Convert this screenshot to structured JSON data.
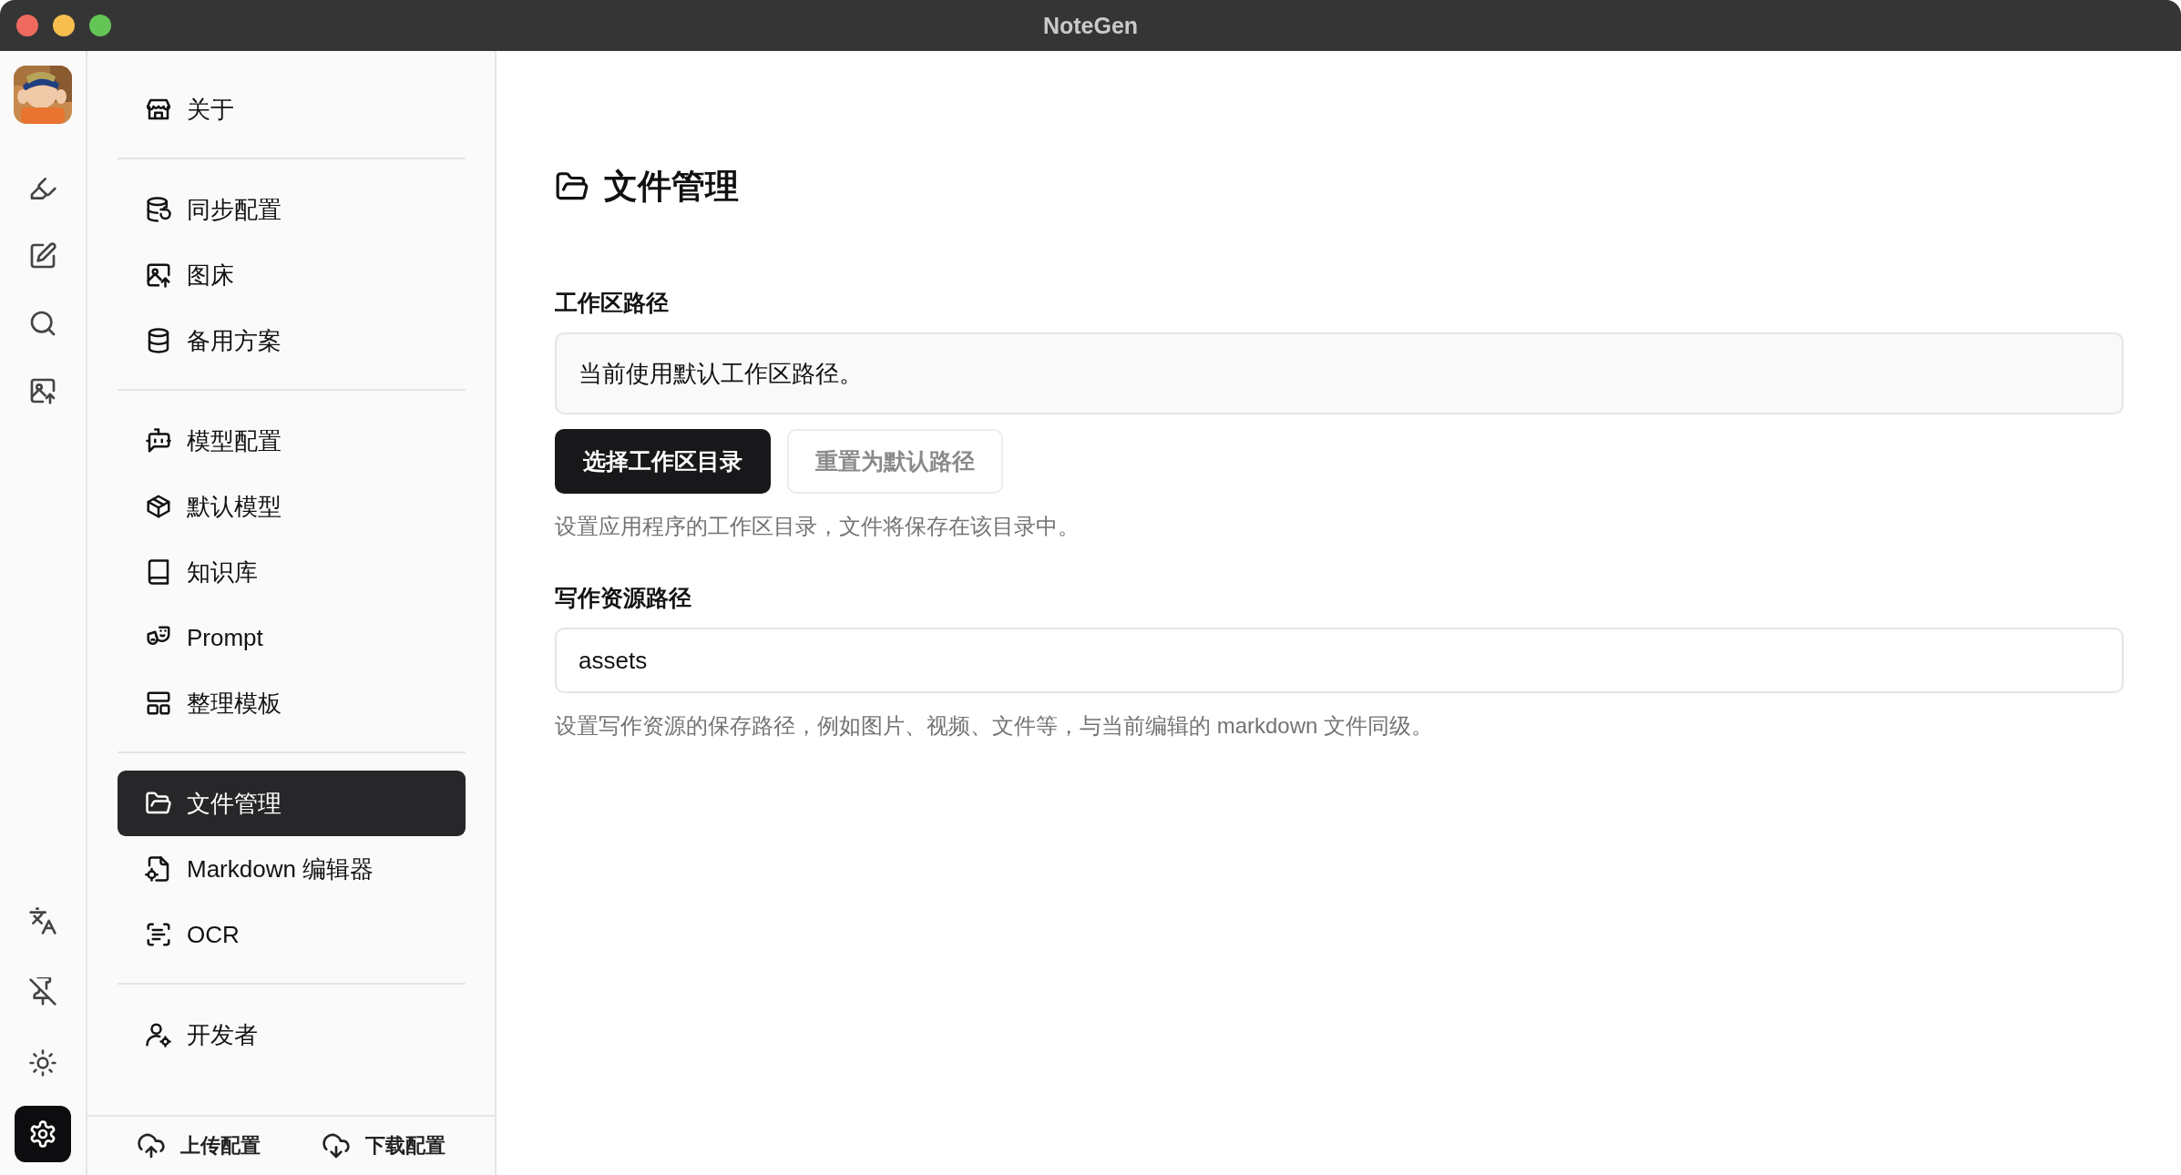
{
  "window": {
    "title": "NoteGen"
  },
  "rail": {
    "top": [
      {
        "selected": false
      },
      {
        "selected": false
      },
      {
        "selected": false
      },
      {
        "selected": false
      }
    ],
    "bottom": [
      {
        "selected": false
      },
      {
        "selected": false
      },
      {
        "selected": false
      },
      {
        "selected": true
      }
    ]
  },
  "sidebar": {
    "groups": [
      [
        {
          "label": "关于",
          "selected": false
        }
      ],
      [
        {
          "label": "同步配置",
          "selected": false
        },
        {
          "label": "图床",
          "selected": false
        },
        {
          "label": "备用方案",
          "selected": false
        }
      ],
      [
        {
          "label": "模型配置",
          "selected": false
        },
        {
          "label": "默认模型",
          "selected": false
        },
        {
          "label": "知识库",
          "selected": false
        },
        {
          "label": "Prompt",
          "selected": false
        },
        {
          "label": "整理模板",
          "selected": false
        }
      ],
      [
        {
          "label": "文件管理",
          "selected": true
        },
        {
          "label": "Markdown 编辑器",
          "selected": false
        },
        {
          "label": "OCR",
          "selected": false
        }
      ],
      [
        {
          "label": "开发者",
          "selected": false
        }
      ]
    ],
    "footer": [
      {
        "label": "上传配置"
      },
      {
        "label": "下载配置"
      }
    ]
  },
  "main": {
    "title": "文件管理",
    "sections": [
      {
        "label": "工作区路径",
        "field": {
          "kind": "display",
          "value": "当前使用默认工作区路径。"
        },
        "buttons": [
          {
            "label": "选择工作区目录",
            "kind": "primary",
            "disabled": false
          },
          {
            "label": "重置为默认路径",
            "kind": "outline",
            "disabled": true
          }
        ],
        "help": "设置应用程序的工作区目录，文件将保存在该目录中。"
      },
      {
        "label": "写作资源路径",
        "field": {
          "kind": "input",
          "value": "assets"
        },
        "help": "设置写作资源的保存路径，例如图片、视频、文件等，与当前编辑的 markdown 文件同级。"
      }
    ]
  }
}
